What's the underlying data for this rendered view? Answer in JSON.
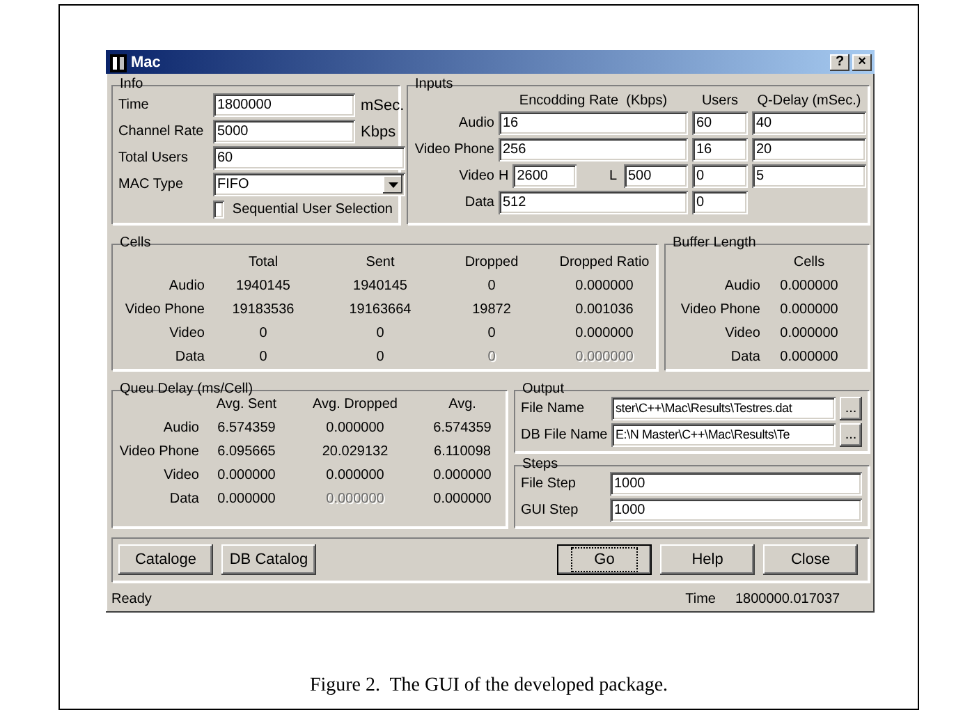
{
  "window": {
    "title": "Mac",
    "title_buttons": [
      "?",
      "×"
    ]
  },
  "info": {
    "title": "Info",
    "fields": [
      {
        "label": "Time",
        "value": "1800000",
        "unit": "mSec.",
        "kind": "text"
      },
      {
        "label": "Channel Rate",
        "value": "5000",
        "unit": "Kbps",
        "kind": "text"
      },
      {
        "label": "Total Users",
        "value": "60",
        "kind": "text"
      },
      {
        "label": "MAC Type",
        "value": "FIFO",
        "kind": "dropdown"
      }
    ],
    "checkbox": {
      "label": "Sequential User Selection",
      "checked": false
    }
  },
  "inputs": {
    "title": "Inputs",
    "columns": [
      "Encodding Rate  (Kbps)",
      "Users",
      "Q-Delay (mSec.)"
    ],
    "rows": [
      {
        "label": "Audio",
        "kind": "single",
        "rate": "16",
        "users": "60",
        "delay": "40"
      },
      {
        "label": "Video Phone",
        "kind": "single",
        "rate": "256",
        "users": "16",
        "delay": "20"
      },
      {
        "label": "Video",
        "kind": "high_low",
        "high_label": "H",
        "high": "2600",
        "low_label": "L",
        "low": "500",
        "users": "0",
        "delay": "5"
      },
      {
        "label": "Data",
        "kind": "single",
        "rate": "512",
        "users": "0"
      }
    ]
  },
  "cells": {
    "title": "Cells",
    "columns": [
      "Total",
      "Sent",
      "Dropped",
      "Dropped Ratio"
    ],
    "rows": [
      {
        "label": "Audio",
        "values": [
          {
            "text": "1940145",
            "disabled": false
          },
          {
            "text": "1940145",
            "disabled": false
          },
          {
            "text": "0",
            "disabled": false
          },
          {
            "text": "0.000000",
            "disabled": false
          }
        ]
      },
      {
        "label": "Video Phone",
        "values": [
          {
            "text": "19183536",
            "disabled": false
          },
          {
            "text": "19163664",
            "disabled": false
          },
          {
            "text": "19872",
            "disabled": false
          },
          {
            "text": "0.001036",
            "disabled": false
          }
        ]
      },
      {
        "label": "Video",
        "values": [
          {
            "text": "0",
            "disabled": false
          },
          {
            "text": "0",
            "disabled": false
          },
          {
            "text": "0",
            "disabled": false
          },
          {
            "text": "0.000000",
            "disabled": false
          }
        ]
      },
      {
        "label": "Data",
        "values": [
          {
            "text": "0",
            "disabled": false
          },
          {
            "text": "0",
            "disabled": false
          },
          {
            "text": "0",
            "disabled": true
          },
          {
            "text": "0.000000",
            "disabled": true
          }
        ]
      }
    ]
  },
  "buffer_length": {
    "title": "Buffer Length",
    "column": "Cells",
    "rows": [
      {
        "label": "Audio",
        "value": "0.000000"
      },
      {
        "label": "Video Phone",
        "value": "0.000000"
      },
      {
        "label": "Video",
        "value": "0.000000"
      },
      {
        "label": "Data",
        "value": "0.000000"
      }
    ]
  },
  "queue_delay": {
    "title": "Queu Delay (ms/Cell)",
    "columns": [
      "Avg. Sent",
      "Avg. Dropped",
      "Avg."
    ],
    "rows": [
      {
        "label": "Audio",
        "values": [
          {
            "text": "6.574359",
            "disabled": false
          },
          {
            "text": "0.000000",
            "disabled": false
          },
          {
            "text": "6.574359",
            "disabled": false
          }
        ]
      },
      {
        "label": "Video Phone",
        "values": [
          {
            "text": "6.095665",
            "disabled": false
          },
          {
            "text": "20.029132",
            "disabled": false
          },
          {
            "text": "6.110098",
            "disabled": false
          }
        ]
      },
      {
        "label": "Video",
        "values": [
          {
            "text": "0.000000",
            "disabled": false
          },
          {
            "text": "0.000000",
            "disabled": false
          },
          {
            "text": "0.000000",
            "disabled": false
          }
        ]
      },
      {
        "label": "Data",
        "values": [
          {
            "text": "0.000000",
            "disabled": false
          },
          {
            "text": "0.000000",
            "disabled": true
          },
          {
            "text": "0.000000",
            "disabled": false
          }
        ]
      }
    ]
  },
  "output": {
    "title": "Output",
    "fields": [
      {
        "label": "File Name",
        "value": "ster\\C++\\Mac\\Results\\Testres.dat",
        "button": "..."
      },
      {
        "label": "DB File Name",
        "value": "E:\\N Master\\C++\\Mac\\Results\\Te",
        "button": "..."
      }
    ]
  },
  "steps": {
    "title": "Steps",
    "fields": [
      {
        "label": "File Step",
        "value": "1000"
      },
      {
        "label": "GUI Step",
        "value": "1000"
      }
    ]
  },
  "buttons": {
    "left": [
      {
        "label": "Cataloge",
        "focused": false
      },
      {
        "label": "DB Catalog",
        "focused": false
      }
    ],
    "right": [
      {
        "label": "Go",
        "focused": true
      },
      {
        "label": "Help",
        "focused": false
      },
      {
        "label": "Close",
        "focused": false
      }
    ]
  },
  "status_bar": {
    "message": "Ready",
    "time_label": "Time",
    "time": "1800000.017037"
  },
  "caption": "Figure 2.  The GUI of the developed package."
}
